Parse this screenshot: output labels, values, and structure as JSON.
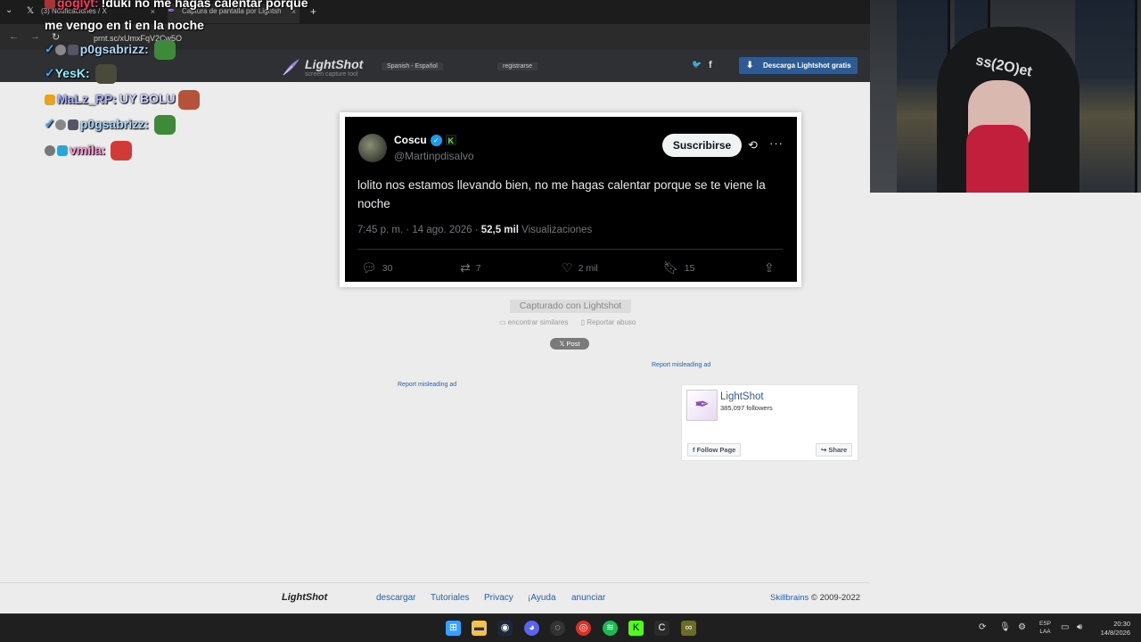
{
  "browser": {
    "tabs": [
      {
        "label": "(3) Notificaciones / X",
        "icon": "𝕏"
      },
      {
        "label": "Captura de pantalla por Lightshot",
        "icon": "✒"
      }
    ],
    "close_glyph": "×",
    "new_tab_glyph": "+",
    "menu_glyph": "⌄",
    "back_glyph": "←",
    "forward_glyph": "→",
    "reload_glyph": "↻",
    "url": "prnt.sc/xUmxFqV2Cw5O"
  },
  "lightshot_header": {
    "logo_name": "LightShot",
    "logo_tagline": "screen capture tool",
    "language": "Spanish - Español",
    "register": "registrarse",
    "twitter_glyph": "🐦",
    "facebook_glyph": "f",
    "download_button": "Descarga Lightshot gratis"
  },
  "tweet": {
    "display_name": "Coscu",
    "handle": "@Martinpdisalvo",
    "verified_glyph": "✓",
    "kick_badge": "K",
    "subscribe_label": "Suscribirse",
    "text": "lolito nos estamos llevando bien, no me hagas calentar porque se te viene la noche",
    "time": "7:45 p. m. · 14 ago. 2026 · ",
    "views_count": "52,5 mil",
    "views_label": " Visualizaciones",
    "replies": "30",
    "reposts": "7",
    "likes": "2 mil",
    "bookmarks": "15"
  },
  "lightshot_page": {
    "captured": "Capturado con Lightshot",
    "find_similar": "encontrar similares",
    "report_abuse": "Reportar abuso",
    "post_button": "𝕏 Post",
    "report_ad_right": "Report misleading ad",
    "report_ad_left": "Report misleading ad"
  },
  "facebook_widget": {
    "page_name": "LightShot",
    "followers": "385,097 followers",
    "follow_label": "Follow Page",
    "share_label": "Share"
  },
  "footer": {
    "logo": "LightShot",
    "links": [
      "descargar",
      "Tutoriales",
      "Privacy",
      "¡Ayuda",
      "anunciar"
    ],
    "company": "Skillbrains",
    "copyright": " © 2009-2022"
  },
  "chat": [
    {
      "user": "goglyt:",
      "message": "!duki no me hagas calentar porque",
      "user_color": "#ff3b5c"
    },
    {
      "user": "",
      "message": "me vengo en ti en la noche",
      "user_color": "#ffffff"
    },
    {
      "user": "p0gsabrizz:",
      "message": "",
      "user_color": "#a8d8ff"
    },
    {
      "user": "YesK:",
      "message": "",
      "user_color": "#8ef0ff"
    },
    {
      "user": "MaLz_RP:",
      "message": "UY BOLU",
      "user_color": "#a8b4ff"
    },
    {
      "user": "p0gsabrizz:",
      "message": "",
      "user_color": "#a8d8ff"
    },
    {
      "user": "vmila:",
      "message": "",
      "user_color": "#ff9ad5"
    }
  ],
  "webcam": {
    "hoodie_text": "ss(2O)et"
  },
  "taskbar": {
    "language": "ESP",
    "language_sub": "LAA",
    "time": "20:30",
    "date": "14/8/2026"
  }
}
